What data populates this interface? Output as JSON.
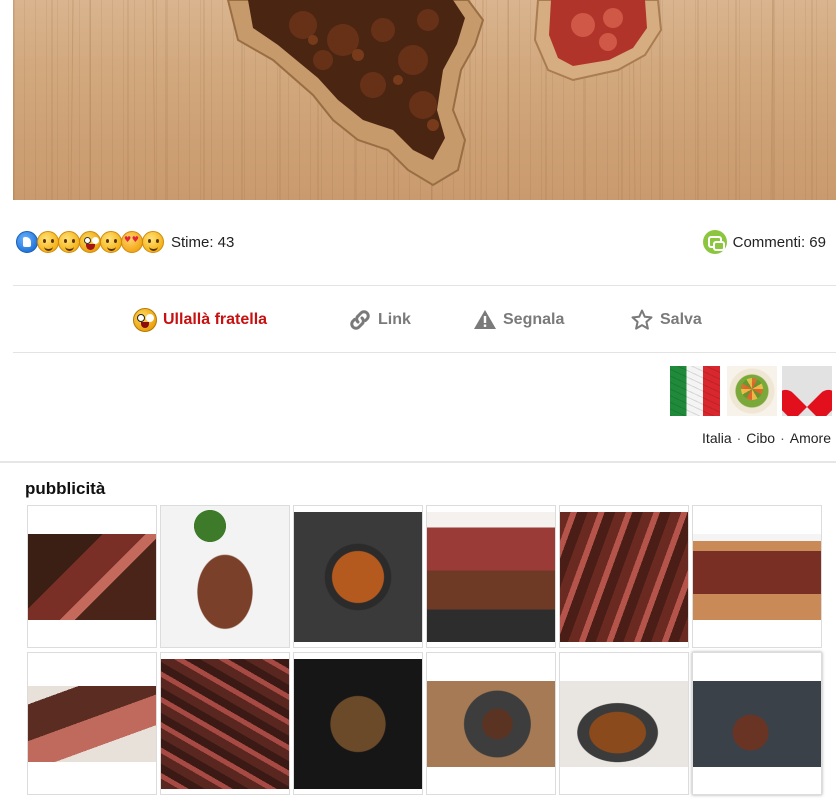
{
  "reactions": {
    "icons": [
      "like-icon",
      "clap-emoji-icon",
      "blush-emoji-icon",
      "shocked-emoji-icon",
      "hug-emoji-icon",
      "heart-eyes-emoji-icon",
      "smile-emoji-icon"
    ],
    "stime_label": "Stime: 43"
  },
  "comments": {
    "label": "Commenti: 69",
    "icon": "comment-bubble-icon"
  },
  "actions": {
    "ullalla": "Ullallà fratella",
    "link": "Link",
    "segnala": "Segnala",
    "salva": "Salva"
  },
  "tags": {
    "italia": "Italia",
    "cibo": "Cibo",
    "amore": "Amore",
    "separator": "·"
  },
  "ad": {
    "title": "pubblicità",
    "items": [
      "steak-sliced-with-fork",
      "steak-with-salad-and-sauce",
      "beef-stew-bowl",
      "fillet-steak-with-rosemary",
      "sliced-steak-on-board",
      "sliced-steak-with-chili",
      "sliced-steak-on-board-2",
      "t-bone-sliced-with-fork",
      "t-bone-steak-dark",
      "grilled-steak-plate",
      "steak-with-sauce-pan",
      "tomahawk-steak-slate"
    ]
  },
  "colors": {
    "primary_red": "#c81010",
    "comment_green": "#8cc63f",
    "adchoices_blue": "#00aecd",
    "muted_gray": "#7a7a7a"
  }
}
